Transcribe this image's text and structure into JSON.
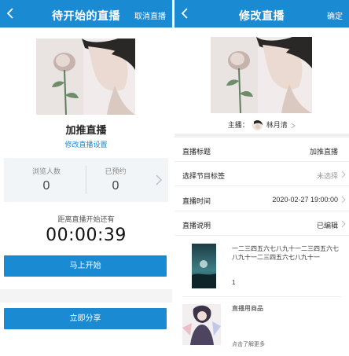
{
  "left": {
    "nav": {
      "title": "待开始的直播",
      "right": "取消直播",
      "back_icon": "chevron-left-icon"
    },
    "title": "加推直播",
    "edit_link": "修改直播设置",
    "stats": [
      {
        "label": "浏览人数",
        "value": "0"
      },
      {
        "label": "已预约",
        "value": "0"
      }
    ],
    "countdown_label": "距离直播开始还有",
    "countdown": "00:00:39",
    "start_button": "马上开始",
    "share_button": "立即分享"
  },
  "right": {
    "nav": {
      "title": "修改直播",
      "right": "确定",
      "back_icon": "chevron-left-icon"
    },
    "host_label": "主播：",
    "host_name": "林月清",
    "rows": [
      {
        "label": "直播标题",
        "value": "加推直播"
      },
      {
        "label": "选择节目标签",
        "value": "未选择"
      },
      {
        "label": "直播时间",
        "value": "2020-02-27 19:00:00"
      },
      {
        "label": "直播说明",
        "value": "已编辑"
      }
    ],
    "program_text": "一二三四五六七八九十一二三四五六七八九十一二三四五六七八九十一",
    "program_count": "1",
    "goods_title": "直播用商品",
    "goods_more": "点击了解更多"
  },
  "colors": {
    "brand": "#1a8ad3",
    "panel": "#f2f5f8"
  }
}
